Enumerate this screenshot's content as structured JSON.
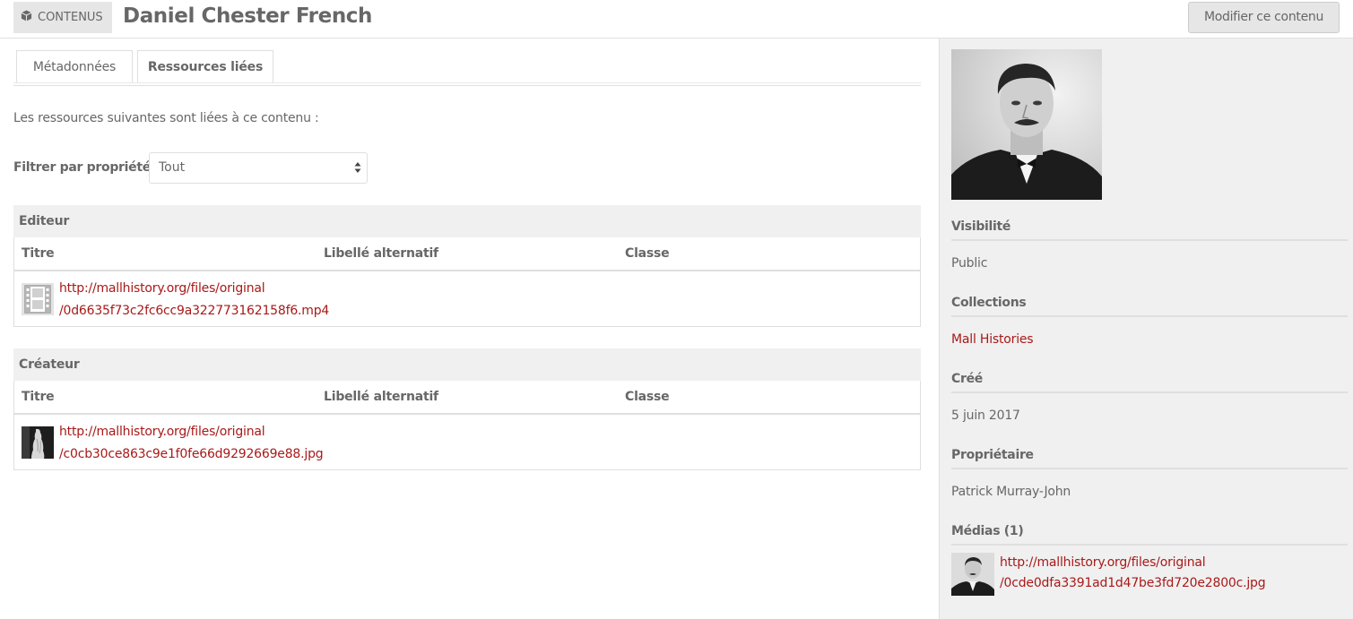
{
  "header": {
    "type_label": "CONTENUS",
    "title": "Daniel Chester French",
    "edit_button": "Modifier ce contenu"
  },
  "tabs": [
    {
      "label": "Métadonnées",
      "active": false
    },
    {
      "label": "Ressources liées",
      "active": true
    }
  ],
  "intro": "Les ressources suivantes sont liées à ce contenu :",
  "filter": {
    "label": "Filtrer par propriété",
    "selected": "Tout"
  },
  "groups": [
    {
      "title": "Editeur",
      "columns": [
        "Titre",
        "Libellé alternatif",
        "Classe"
      ],
      "rows": [
        {
          "link_line1": "http://mallhistory.org/files/original",
          "link_line2": "/0d6635f73c2fc6cc9a322773162158f6.mp4",
          "thumb": "video-file-icon"
        }
      ]
    },
    {
      "title": "Créateur",
      "columns": [
        "Titre",
        "Libellé alternatif",
        "Classe"
      ],
      "rows": [
        {
          "link_line1": "http://mallhistory.org/files/original",
          "link_line2": "/c0cb30ce863c9e1f0fe66d9292669e88.jpg",
          "thumb": "statue-thumbnail"
        }
      ]
    }
  ],
  "sidebar": {
    "visibility": {
      "heading": "Visibilité",
      "value": "Public"
    },
    "collections": {
      "heading": "Collections",
      "value": "Mall Histories"
    },
    "created": {
      "heading": "Créé",
      "value": "5 juin 2017"
    },
    "owner": {
      "heading": "Propriétaire",
      "value": "Patrick Murray-John"
    },
    "media": {
      "heading": "Médias (1)",
      "link_line1": "http://mallhistory.org/files/original",
      "link_line2": "/0cde0dfa3391ad1d47be3fd720e2800c.jpg"
    }
  },
  "colors": {
    "link": "#a91919",
    "text": "#676767",
    "panel": "#f0f0f0",
    "border": "#dfdfdf"
  }
}
